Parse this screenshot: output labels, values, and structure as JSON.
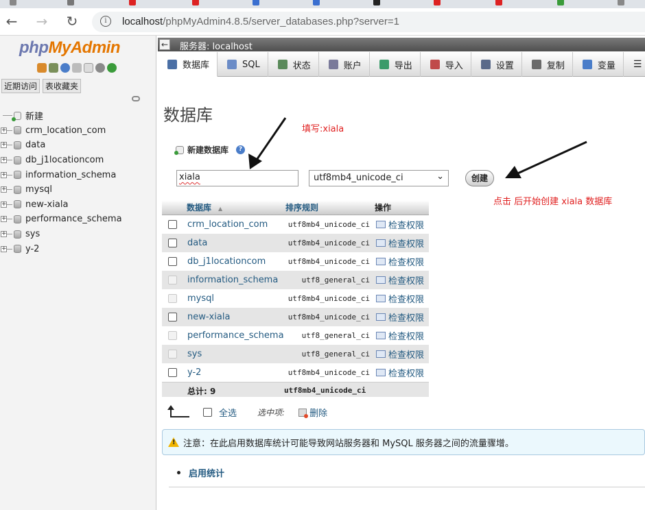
{
  "browser": {
    "url_host": "localhost",
    "url_path": "/phpMyAdmin4.8.5/server_databases.php?server=1"
  },
  "nav": {
    "logo_php": "php",
    "logo_myadmin": "MyAdmin",
    "recent": "近期访问",
    "favorites": "表收藏夹",
    "new_label": "新建",
    "databases": [
      "crm_location_com",
      "data",
      "db_j1locationcom",
      "information_schema",
      "mysql",
      "new-xiala",
      "performance_schema",
      "sys",
      "y-2"
    ]
  },
  "server_bar": {
    "title": "服务器: localhost"
  },
  "menu": [
    {
      "label": "数据库",
      "icon": "database-icon",
      "active": true
    },
    {
      "label": "SQL",
      "icon": "sql-icon",
      "active": false
    },
    {
      "label": "状态",
      "icon": "status-icon",
      "active": false
    },
    {
      "label": "账户",
      "icon": "accounts-icon",
      "active": false
    },
    {
      "label": "导出",
      "icon": "export-icon",
      "active": false
    },
    {
      "label": "导入",
      "icon": "import-icon",
      "active": false
    },
    {
      "label": "设置",
      "icon": "settings-icon",
      "active": false
    },
    {
      "label": "复制",
      "icon": "replication-icon",
      "active": false
    },
    {
      "label": "变量",
      "icon": "variables-icon",
      "active": false
    }
  ],
  "page": {
    "title": "数据库",
    "new_db_label": "新建数据库",
    "db_name_value": "xiala",
    "collation_value": "utf8mb4_unicode_ci",
    "create_button": "创建"
  },
  "annotations": {
    "fill_hint": "填写:xiala",
    "click_hint": "点击 后开始创建 xiala 数据库"
  },
  "table": {
    "headers": {
      "database": "数据库",
      "collation": "排序规则",
      "action": "操作"
    },
    "rows": [
      {
        "name": "crm_location_com",
        "collation": "utf8mb4_unicode_ci",
        "action": "检查权限",
        "selectable": true
      },
      {
        "name": "data",
        "collation": "utf8mb4_unicode_ci",
        "action": "检查权限",
        "selectable": true
      },
      {
        "name": "db_j1locationcom",
        "collation": "utf8mb4_unicode_ci",
        "action": "检查权限",
        "selectable": true
      },
      {
        "name": "information_schema",
        "collation": "utf8_general_ci",
        "action": "检查权限",
        "selectable": false
      },
      {
        "name": "mysql",
        "collation": "utf8mb4_unicode_ci",
        "action": "检查权限",
        "selectable": false
      },
      {
        "name": "new-xiala",
        "collation": "utf8mb4_unicode_ci",
        "action": "检查权限",
        "selectable": true
      },
      {
        "name": "performance_schema",
        "collation": "utf8_general_ci",
        "action": "检查权限",
        "selectable": false
      },
      {
        "name": "sys",
        "collation": "utf8_general_ci",
        "action": "检查权限",
        "selectable": false
      },
      {
        "name": "y-2",
        "collation": "utf8mb4_unicode_ci",
        "action": "检查权限",
        "selectable": true
      }
    ],
    "total_label": "总计: 9",
    "total_collation": "utf8mb4_unicode_ci"
  },
  "with_selected": {
    "select_all": "全选",
    "selected_label": "选中项:",
    "delete": "删除"
  },
  "notice": {
    "text": "注意：在此启用数据库统计可能导致网站服务器和 MySQL 服务器之间的流量骤增。"
  },
  "enable_stats": "启用统计"
}
